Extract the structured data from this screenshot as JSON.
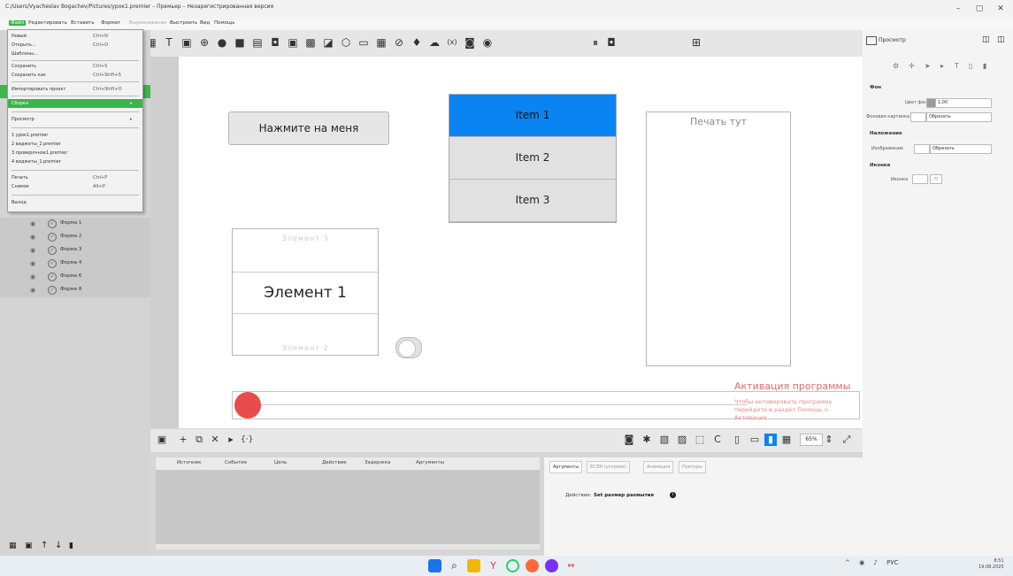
{
  "window": {
    "title": "C:/Users/Vyacheslav Bogachev/Pictures/урок1.premier – Премьер – Незарегистрированная версия",
    "controls": [
      "–",
      "▢",
      "✕"
    ]
  },
  "menubar": {
    "items": [
      "Файл",
      "Редактировать",
      "Вставить",
      "Формат",
      "Выравнивание",
      "Выстроить",
      "Вид",
      "Помощь"
    ]
  },
  "file_menu": {
    "items": [
      {
        "label": "Новый",
        "shortcut": "Ctrl+N"
      },
      {
        "label": "Открыть...",
        "shortcut": "Ctrl+O"
      },
      {
        "label": "Шаблоны...",
        "shortcut": ""
      },
      {
        "label": "Сохранить",
        "shortcut": "Ctrl+S"
      },
      {
        "label": "Сохранить как",
        "shortcut": "Ctrl+Shift+S"
      },
      {
        "label": "Импортировать проект",
        "shortcut": "Ctrl+Shift+O"
      },
      {
        "label": "Сборка",
        "shortcut": "▸"
      },
      {
        "label": "Просмотр",
        "shortcut": "▸"
      },
      {
        "label": "1 урок1.premier",
        "shortcut": ""
      },
      {
        "label": "2 виджеты_2.premier",
        "shortcut": ""
      },
      {
        "label": "3 проверочное1.premier",
        "shortcut": ""
      },
      {
        "label": "4 виджеты_1.premier",
        "shortcut": ""
      },
      {
        "label": "Печать",
        "shortcut": "Ctrl+P"
      },
      {
        "label": "Снимок",
        "shortcut": "Alt+P"
      },
      {
        "label": "Выход",
        "shortcut": ""
      }
    ]
  },
  "layers": {
    "items": [
      "Форма 1",
      "Форма 2",
      "Форма 3",
      "Форма 4",
      "Форма 6",
      "Форма 8"
    ]
  },
  "canvas": {
    "button_label": "Нажмите на меня",
    "list_items": [
      "Item 1",
      "Item 2",
      "Item 3"
    ],
    "selected_list_item": "Item 1",
    "print_placeholder": "Печать тут",
    "spinner_items": {
      "top": "Элемент 3",
      "current": "Элемент 1",
      "bottom": "Элемент 2"
    },
    "toggle_on": false,
    "slider_value": 0
  },
  "activation": {
    "title": "Активация программы",
    "text": "Чтобы активировать программу перейдите в раздел Помощь > Активация"
  },
  "bottom_toolbar": {
    "zoom": "65%"
  },
  "event_table": {
    "columns": [
      "Источник",
      "Событие",
      "Цель",
      "Действие",
      "Задержка",
      "Аргументы"
    ]
  },
  "properties": {
    "tabs": [
      "Аргументы",
      "ЕСЛИ (условие)",
      "Анимация",
      "Повторы"
    ],
    "action_label": "Действие:",
    "action_value": "Set размер размытия"
  },
  "right_panel": {
    "preview_label": "Просмотр",
    "background_section": "Фон",
    "bg_color_label": "Цвет фона",
    "bg_opacity": "1,00",
    "bg_image_label": "Фоновая картинка",
    "bg_image_mode": "Обрезать",
    "overlay_section": "Наложение",
    "overlay_image_label": "Изображение",
    "overlay_mode": "Обрезать",
    "icon_section": "Иконка",
    "icon_label": "Иконка"
  },
  "taskbar": {
    "lang": "РУС",
    "time": "8:51",
    "date": "19.08.2025"
  },
  "colors": {
    "accent_green": "#39b54a",
    "selection_blue": "#0a84f2",
    "slider_red": "#e94b4b"
  }
}
